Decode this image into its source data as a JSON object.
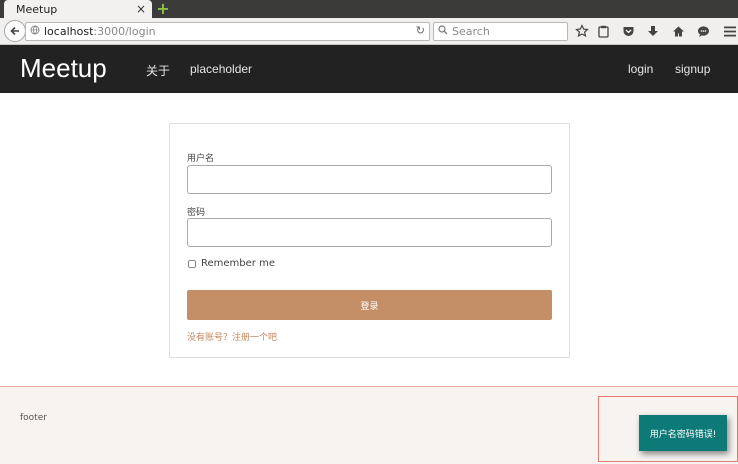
{
  "browser": {
    "tab_title": "Meetup",
    "tab_close": "×",
    "new_tab": "+",
    "url_host": "localhost",
    "url_path": ":3000/login",
    "search_placeholder": "Search"
  },
  "navbar": {
    "brand": "Meetup",
    "links": [
      {
        "label": "关于"
      },
      {
        "label": "placeholder"
      }
    ],
    "right_links": [
      {
        "label": "login"
      },
      {
        "label": "signup"
      }
    ]
  },
  "login_form": {
    "username_label": "用户名",
    "username_value": "",
    "password_label": "密码",
    "password_value": "",
    "remember_label": "Remember me",
    "remember_checked": false,
    "submit_label": "登录",
    "register_link": "没有账号？注册一个吧"
  },
  "footer": {
    "text": "footer"
  },
  "toast": {
    "message": "用户名密码错误!"
  },
  "colors": {
    "navbar_bg": "#222222",
    "button_bg": "#c48f67",
    "link_color": "#c4875e",
    "toast_bg": "#0d7a78",
    "footer_bg": "#f7f3f1"
  }
}
